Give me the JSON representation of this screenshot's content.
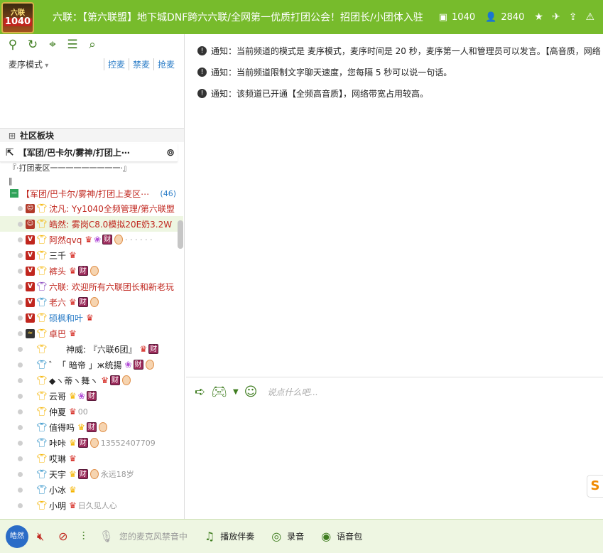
{
  "header": {
    "logo_top": "六联",
    "logo_num": "1040",
    "title": "六联：【第六联盟】地下城DNF跨六六联/全网第一优质打团公会！招团长/小团体入驻",
    "channel_id": "1040",
    "online_count": "2840"
  },
  "left": {
    "mode": "麦序模式",
    "links": [
      "控麦",
      "禁麦",
      "抢麦"
    ],
    "section_title": "社区板块",
    "pinned_channel": "【军团/巴卡尔/雾神/打团上⋯",
    "sub_rows": [
      "『·打团麦区一一一一一一一一一·』",
      "‖"
    ],
    "open_channel": "【军团/巴卡尔/雾神/打团上麦区⋯",
    "open_channel_count": "(46)"
  },
  "members": [
    {
      "badge": "star",
      "role": "gold",
      "name": "沈凡: Yy1040全频管理/第六联盟",
      "color": "red",
      "crowns": 0,
      "extra": ""
    },
    {
      "badge": "star",
      "role": "gold",
      "name": "皓然: 雾岗C8.0模拟20E奶3.2W",
      "color": "red",
      "crowns": 0,
      "extra": "",
      "selected": true
    },
    {
      "badge": "v",
      "role": "gold",
      "name": "阿然qvq",
      "color": "red",
      "crowns": 1,
      "gift": true,
      "cai": true,
      "medal": true,
      "extra": "· · · · · ·"
    },
    {
      "badge": "v",
      "role": "gold",
      "name": "三千",
      "color": "black",
      "crowns": 1,
      "extra": ""
    },
    {
      "badge": "v",
      "role": "gold",
      "name": "裤头",
      "color": "red",
      "crowns": 1,
      "cai": true,
      "medal": true,
      "extra": ""
    },
    {
      "badge": "v",
      "role": "purple",
      "name": "六联: 欢迎所有六联团长和新老玩",
      "color": "red",
      "crowns": 0,
      "extra": ""
    },
    {
      "badge": "v",
      "role": "blue",
      "name": "老六",
      "color": "red",
      "crowns": 1,
      "cai": true,
      "medal": true,
      "extra": ""
    },
    {
      "badge": "v",
      "role": "gold",
      "name": "硕枫和叶",
      "color": "blue",
      "crowns": 1,
      "extra": ""
    },
    {
      "badge": "s",
      "role": "gold",
      "name": "卓巴",
      "color": "red",
      "crowns": 1,
      "extra": ""
    },
    {
      "badge": "none",
      "role": "gold",
      "name": "　　神威: 『六联6团』",
      "color": "black",
      "crowns": 1,
      "cai": true,
      "extra": ""
    },
    {
      "badge": "none",
      "role": "blue",
      "name": "゛「 暗帝 」ж统揚",
      "color": "black",
      "crowns": 0,
      "gift": true,
      "cai": true,
      "medal": true,
      "extra": ""
    },
    {
      "badge": "none",
      "role": "gold",
      "name": "◆ヽ蒂ヽ舞ヽ",
      "color": "black",
      "crowns": 1,
      "cai": true,
      "medal": true,
      "extra": ""
    },
    {
      "badge": "none",
      "role": "gold",
      "name": "云哥",
      "color": "black",
      "crowns": 1,
      "gold": true,
      "gift": true,
      "cai": true,
      "extra": ""
    },
    {
      "badge": "none",
      "role": "gold",
      "name": "仲夏",
      "color": "black",
      "crowns": 1,
      "extra": "00"
    },
    {
      "badge": "none",
      "role": "blue",
      "name": "值得吗",
      "color": "black",
      "crowns": 1,
      "gold": true,
      "cai": true,
      "medal": true,
      "extra": ""
    },
    {
      "badge": "none",
      "role": "blue",
      "name": "咔咔",
      "color": "black",
      "crowns": 1,
      "gold": true,
      "cai": true,
      "medal": true,
      "extra": "13552407709"
    },
    {
      "badge": "none",
      "role": "gold",
      "name": "哎琳",
      "color": "black",
      "crowns": 1,
      "extra": ""
    },
    {
      "badge": "none",
      "role": "blue",
      "name": "天宇",
      "color": "black",
      "crowns": 1,
      "gold": true,
      "cai": true,
      "medal": true,
      "extra": "永远18岁"
    },
    {
      "badge": "none",
      "role": "blue",
      "name": "小冰",
      "color": "black",
      "crowns": 1,
      "gold": true,
      "extra": ""
    },
    {
      "badge": "none",
      "role": "gold",
      "name": "小明",
      "color": "black",
      "crowns": 1,
      "extra": "日久见人心"
    }
  ],
  "notices": [
    "通知：当前频道的模式是 麦序模式，麦序时间是 20 秒，麦序第一人和管理员可以发言。【高音质，网络",
    "通知：当前频道限制文字聊天速度，您每隔 5 秒可以说一句话。",
    "通知：该频道已开通【全频高音质】，网络带宽占用较高。"
  ],
  "chat": {
    "placeholder": "说点什么吧..."
  },
  "bottom": {
    "avatar_label": "皓然",
    "mic_status": "您的麦克风禁音中",
    "play_music": "播放伴奏",
    "record": "录音",
    "voice_pack": "语音包"
  },
  "colors": {
    "header_green": "#77bb2c",
    "accent_red": "#c0261e",
    "link_blue": "#2a7cc7"
  }
}
